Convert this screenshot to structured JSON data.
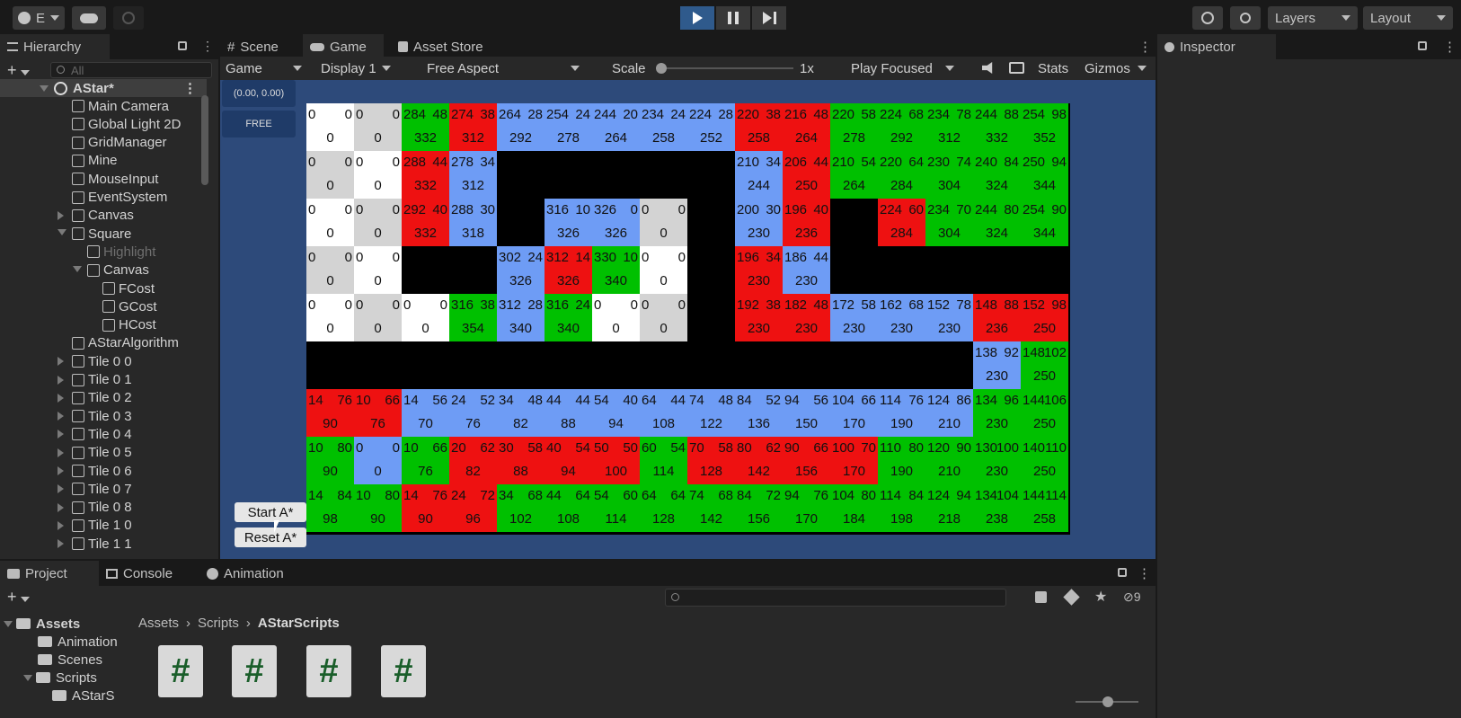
{
  "toolbar": {
    "account_label": "E",
    "layers_label": "Layers",
    "layout_label": "Layout"
  },
  "hierarchy": {
    "tab_label": "Hierarchy",
    "search_placeholder": "All",
    "scene_label": "AStar*",
    "items": [
      "Main Camera",
      "Global Light 2D",
      "GridManager",
      "Mine",
      "MouseInput",
      "EventSystem",
      "Canvas",
      "Square",
      "Highlight",
      "Canvas",
      "FCost",
      "GCost",
      "HCost",
      "AStarAlgorithm",
      "Tile 0 0",
      "Tile 0 1",
      "Tile 0 2",
      "Tile 0 3",
      "Tile 0 4",
      "Tile 0 5",
      "Tile 0 6",
      "Tile 0 7",
      "Tile 0 8",
      "Tile 1 0",
      "Tile 1 1"
    ]
  },
  "center_tabs": {
    "scene": "Scene",
    "game": "Game",
    "asset_store": "Asset Store"
  },
  "game_bar": {
    "mode": "Game",
    "display": "Display 1",
    "aspect": "Free Aspect",
    "scale_label": "Scale",
    "scale_value": "1x",
    "play_focused": "Play Focused",
    "stats": "Stats",
    "gizmos": "Gizmos"
  },
  "game_overlay": {
    "coord": "(0.00, 0.00)",
    "free": "FREE",
    "start_button": "Start A*",
    "reset_button": "Reset A*"
  },
  "inspector": {
    "tab_label": "Inspector"
  },
  "bottom": {
    "tabs": {
      "project": "Project",
      "console": "Console",
      "animation": "Animation"
    },
    "hidden_count": "9",
    "tree": [
      "Assets",
      "Animation",
      "Scenes",
      "Scripts",
      "AStarS"
    ],
    "breadcrumb": [
      "Assets",
      "Scripts",
      "AStarScripts"
    ]
  },
  "colors": {
    "green": "#00c000",
    "red": "#ee1111",
    "blue": "#6e9cf5",
    "white": "#ffffff",
    "gray": "#d3d3d3",
    "black": "#000000"
  },
  "grid": [
    [
      [
        "w",
        "0",
        "0",
        "0"
      ],
      [
        "g",
        "0",
        "0",
        "0"
      ],
      [
        "G",
        "284",
        "48",
        "332"
      ],
      [
        "R",
        "274",
        "38",
        "312"
      ],
      [
        "B",
        "264",
        "28",
        "292"
      ],
      [
        "B",
        "254",
        "24",
        "278"
      ],
      [
        "B",
        "244",
        "20",
        "264"
      ],
      [
        "B",
        "234",
        "24",
        "258"
      ],
      [
        "B",
        "224",
        "28",
        "252"
      ],
      [
        "R",
        "220",
        "38",
        "258"
      ],
      [
        "R",
        "216",
        "48",
        "264"
      ],
      [
        "G",
        "220",
        "58",
        "278"
      ],
      [
        "G",
        "224",
        "68",
        "292"
      ],
      [
        "G",
        "234",
        "78",
        "312"
      ],
      [
        "G",
        "244",
        "88",
        "332"
      ],
      [
        "G",
        "254",
        "98",
        "352"
      ]
    ],
    [
      [
        "g",
        "0",
        "0",
        "0"
      ],
      [
        "w",
        "0",
        "0",
        "0"
      ],
      [
        "R",
        "288",
        "44",
        "332"
      ],
      [
        "B",
        "278",
        "34",
        "312"
      ],
      [
        "K"
      ],
      [
        "K"
      ],
      [
        "K"
      ],
      [
        "K"
      ],
      [
        "K"
      ],
      [
        "B",
        "210",
        "34",
        "244"
      ],
      [
        "R",
        "206",
        "44",
        "250"
      ],
      [
        "G",
        "210",
        "54",
        "264"
      ],
      [
        "G",
        "220",
        "64",
        "284"
      ],
      [
        "G",
        "230",
        "74",
        "304"
      ],
      [
        "G",
        "240",
        "84",
        "324"
      ],
      [
        "G",
        "250",
        "94",
        "344"
      ]
    ],
    [
      [
        "w",
        "0",
        "0",
        "0"
      ],
      [
        "g",
        "0",
        "0",
        "0"
      ],
      [
        "R",
        "292",
        "40",
        "332"
      ],
      [
        "B",
        "288",
        "30",
        "318"
      ],
      [
        "K"
      ],
      [
        "B",
        "316",
        "10",
        "326"
      ],
      [
        "B",
        "326",
        "0",
        "326"
      ],
      [
        "g",
        "0",
        "0",
        "0"
      ],
      [
        "K"
      ],
      [
        "B",
        "200",
        "30",
        "230"
      ],
      [
        "R",
        "196",
        "40",
        "236"
      ],
      [
        "K"
      ],
      [
        "R",
        "224",
        "60",
        "284"
      ],
      [
        "G",
        "234",
        "70",
        "304"
      ],
      [
        "G",
        "244",
        "80",
        "324"
      ],
      [
        "G",
        "254",
        "90",
        "344"
      ]
    ],
    [
      [
        "g",
        "0",
        "0",
        "0"
      ],
      [
        "w",
        "0",
        "0",
        "0"
      ],
      [
        "K"
      ],
      [
        "K"
      ],
      [
        "B",
        "302",
        "24",
        "326"
      ],
      [
        "R",
        "312",
        "14",
        "326"
      ],
      [
        "G",
        "330",
        "10",
        "340"
      ],
      [
        "w",
        "0",
        "0",
        "0"
      ],
      [
        "K"
      ],
      [
        "R",
        "196",
        "34",
        "230"
      ],
      [
        "B",
        "186",
        "44",
        "230"
      ],
      [
        "K"
      ],
      [
        "K"
      ],
      [
        "K"
      ],
      [
        "K"
      ],
      [
        "K"
      ]
    ],
    [
      [
        "w",
        "0",
        "0",
        "0"
      ],
      [
        "g",
        "0",
        "0",
        "0"
      ],
      [
        "w",
        "0",
        "0",
        "0"
      ],
      [
        "G",
        "316",
        "38",
        "354"
      ],
      [
        "B",
        "312",
        "28",
        "340"
      ],
      [
        "G",
        "316",
        "24",
        "340"
      ],
      [
        "w",
        "0",
        "0",
        "0"
      ],
      [
        "g",
        "0",
        "0",
        "0"
      ],
      [
        "K"
      ],
      [
        "R",
        "192",
        "38",
        "230"
      ],
      [
        "R",
        "182",
        "48",
        "230"
      ],
      [
        "B",
        "172",
        "58",
        "230"
      ],
      [
        "B",
        "162",
        "68",
        "230"
      ],
      [
        "B",
        "152",
        "78",
        "230"
      ],
      [
        "R",
        "148",
        "88",
        "236"
      ],
      [
        "R",
        "152",
        "98",
        "250"
      ]
    ],
    [
      [
        "K"
      ],
      [
        "K"
      ],
      [
        "K"
      ],
      [
        "K"
      ],
      [
        "K"
      ],
      [
        "K"
      ],
      [
        "K"
      ],
      [
        "K"
      ],
      [
        "K"
      ],
      [
        "K"
      ],
      [
        "K"
      ],
      [
        "K"
      ],
      [
        "K"
      ],
      [
        "K"
      ],
      [
        "B",
        "138",
        "92",
        "230"
      ],
      [
        "G",
        "148",
        "102",
        "250"
      ]
    ],
    [
      [
        "R",
        "14",
        "76",
        "90"
      ],
      [
        "R",
        "10",
        "66",
        "76"
      ],
      [
        "B",
        "14",
        "56",
        "70"
      ],
      [
        "B",
        "24",
        "52",
        "76"
      ],
      [
        "B",
        "34",
        "48",
        "82"
      ],
      [
        "B",
        "44",
        "44",
        "88"
      ],
      [
        "B",
        "54",
        "40",
        "94"
      ],
      [
        "B",
        "64",
        "44",
        "108"
      ],
      [
        "B",
        "74",
        "48",
        "122"
      ],
      [
        "B",
        "84",
        "52",
        "136"
      ],
      [
        "B",
        "94",
        "56",
        "150"
      ],
      [
        "B",
        "104",
        "66",
        "170"
      ],
      [
        "B",
        "114",
        "76",
        "190"
      ],
      [
        "B",
        "124",
        "86",
        "210"
      ],
      [
        "G",
        "134",
        "96",
        "230"
      ],
      [
        "G",
        "144",
        "106",
        "250"
      ]
    ],
    [
      [
        "G",
        "10",
        "80",
        "90"
      ],
      [
        "B",
        "0",
        "0",
        "0"
      ],
      [
        "G",
        "10",
        "66",
        "76"
      ],
      [
        "R",
        "20",
        "62",
        "82"
      ],
      [
        "R",
        "30",
        "58",
        "88"
      ],
      [
        "R",
        "40",
        "54",
        "94"
      ],
      [
        "R",
        "50",
        "50",
        "100"
      ],
      [
        "G",
        "60",
        "54",
        "114"
      ],
      [
        "R",
        "70",
        "58",
        "128"
      ],
      [
        "R",
        "80",
        "62",
        "142"
      ],
      [
        "R",
        "90",
        "66",
        "156"
      ],
      [
        "R",
        "100",
        "70",
        "170"
      ],
      [
        "G",
        "110",
        "80",
        "190"
      ],
      [
        "G",
        "120",
        "90",
        "210"
      ],
      [
        "G",
        "130",
        "100",
        "230"
      ],
      [
        "G",
        "140",
        "110",
        "250"
      ]
    ],
    [
      [
        "G",
        "14",
        "84",
        "98"
      ],
      [
        "G",
        "10",
        "80",
        "90"
      ],
      [
        "R",
        "14",
        "76",
        "90"
      ],
      [
        "R",
        "24",
        "72",
        "96"
      ],
      [
        "G",
        "34",
        "68",
        "102"
      ],
      [
        "G",
        "44",
        "64",
        "108"
      ],
      [
        "G",
        "54",
        "60",
        "114"
      ],
      [
        "G",
        "64",
        "64",
        "128"
      ],
      [
        "G",
        "74",
        "68",
        "142"
      ],
      [
        "G",
        "84",
        "72",
        "156"
      ],
      [
        "G",
        "94",
        "76",
        "170"
      ],
      [
        "G",
        "104",
        "80",
        "184"
      ],
      [
        "G",
        "114",
        "84",
        "198"
      ],
      [
        "G",
        "124",
        "94",
        "218"
      ],
      [
        "G",
        "134",
        "104",
        "238"
      ],
      [
        "G",
        "144",
        "114",
        "258"
      ]
    ]
  ]
}
